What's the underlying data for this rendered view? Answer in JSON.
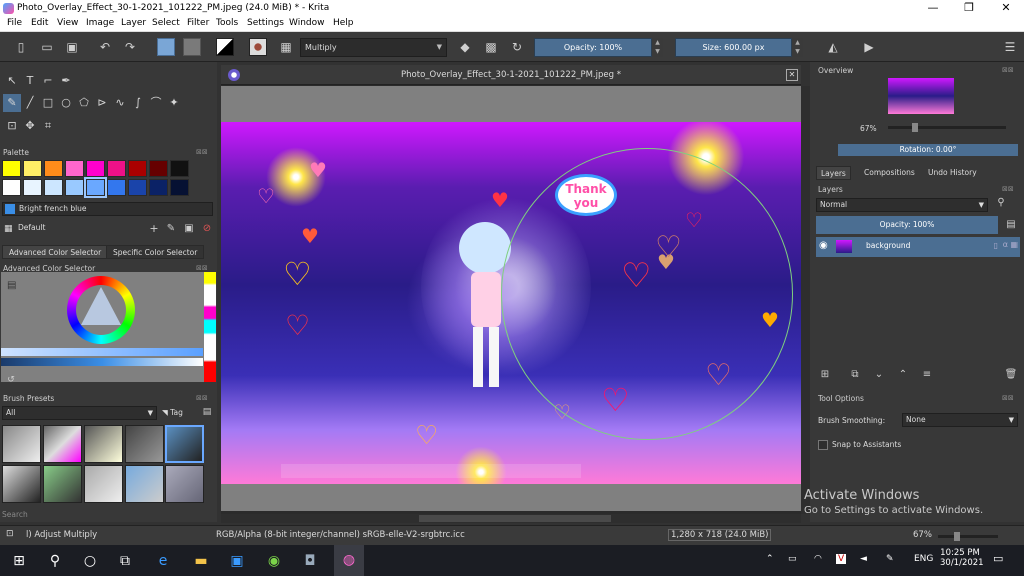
{
  "window": {
    "title": "Photo_Overlay_Effect_30-1-2021_101222_PM.jpeg (24.0 MiB)  * - Krita",
    "minimize": "—",
    "maximize": "❐",
    "close": "✕"
  },
  "menu": [
    "File",
    "Edit",
    "View",
    "Image",
    "Layer",
    "Select",
    "Filter",
    "Tools",
    "Settings",
    "Window",
    "Help"
  ],
  "toolbar": {
    "blend_mode": "Multiply",
    "opacity": "Opacity: 100%",
    "size": "Size: 600.00 px"
  },
  "left_panel": {
    "palette_label": "Palette",
    "current_color_name": "Bright french blue",
    "palette_set": "Default",
    "tab_advanced": "Advanced Color Selector",
    "tab_specific": "Specific Color Selector",
    "advanced_title": "Advanced Color Selector",
    "brush_presets_label": "Brush Presets",
    "brush_filter": "All",
    "tag_label": "Tag",
    "search_placeholder": "Search",
    "swatches": [
      "#ffff00",
      "#ffee66",
      "#ff8c1a",
      "#ff66cc",
      "#ff00cc",
      "#ee1188",
      "#aa0000",
      "#660000",
      "#111111",
      "#ffffff",
      "#e8f4ff",
      "#cce6ff",
      "#99c9ff",
      "#6aa8ff",
      "#3377ee",
      "#1a44aa",
      "#0b2266",
      "#061133"
    ]
  },
  "document": {
    "tab_title": "Photo_Overlay_Effect_30-1-2021_101222_PM.jpeg *",
    "speech_bubble": "Thank you"
  },
  "right_panel": {
    "overview_label": "Overview",
    "zoom": "67%",
    "rotation": "Rotation: 0.00°",
    "tab_layers": "Layers",
    "tab_compositions": "Compositions",
    "tab_undo": "Undo History",
    "layers_label": "Layers",
    "layer_blend": "Normal",
    "layer_opacity": "Opacity:  100%",
    "layer_name": "background",
    "tool_options_label": "Tool Options",
    "brush_smoothing_label": "Brush Smoothing:",
    "brush_smoothing_value": "None",
    "snap_label": "Snap to Assistants"
  },
  "status": {
    "tool": "l) Adjust Multiply",
    "color_model": "RGB/Alpha (8-bit integer/channel)  sRGB-elle-V2-srgbtrc.icc",
    "dimensions": "1,280 x 718 (24.0 MiB)",
    "zoom": "67%"
  },
  "activate": {
    "line1": "Activate Windows",
    "line2": "Go to Settings to activate Windows."
  },
  "taskbar": {
    "lang": "ENG",
    "time": "10:25 PM",
    "date": "30/1/2021"
  }
}
